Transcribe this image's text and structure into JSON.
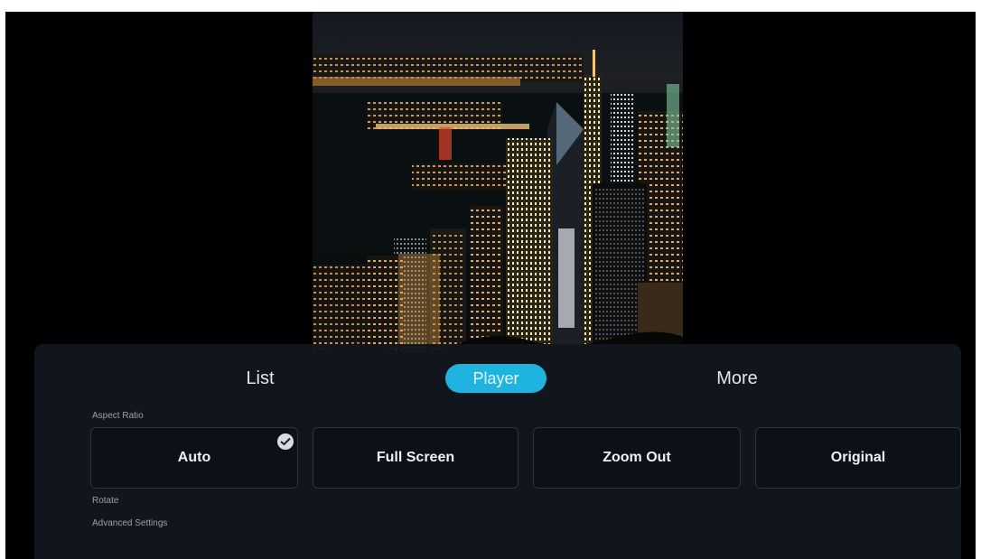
{
  "tabs": {
    "list_label": "List",
    "player_label": "Player",
    "more_label": "More",
    "active": "Player"
  },
  "aspect_ratio": {
    "section_label": "Aspect Ratio",
    "options": [
      "Auto",
      "Full Screen",
      "Zoom Out",
      "Original"
    ],
    "selected": "Auto"
  },
  "rotate_label": "Rotate",
  "advanced_label": "Advanced Settings",
  "colors": {
    "accent": "#1fb3df",
    "panel_bg": "#121820",
    "screen_bg": "#000000"
  },
  "icons": {
    "selected_indicator": "check-icon"
  }
}
